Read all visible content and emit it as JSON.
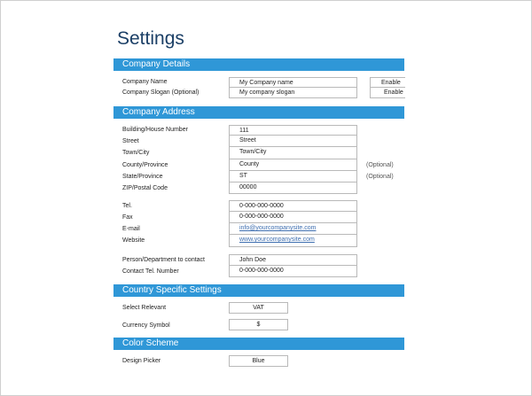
{
  "page_title": "Settings",
  "sections": {
    "company_details": "Company Details",
    "company_address": "Company Address",
    "country_settings": "Country Specific Settings",
    "color_scheme": "Color Scheme"
  },
  "company_details": {
    "name_label": "Company Name",
    "name_value": "My Company name",
    "slogan_label": "Company Slogan (Optional)",
    "slogan_value": "My company slogan",
    "enable_1": "Enable",
    "enable_2": "Enable"
  },
  "address": {
    "building_label": "Building/House Number",
    "building_value": "111",
    "street_label": "Street",
    "street_value": "Street",
    "town_label": "Town/City",
    "town_value": "Town/City",
    "county_label": "County/Province",
    "county_value": "County",
    "county_note": "(Optional)",
    "state_label": "State/Province",
    "state_value": "ST",
    "state_note": "(Optional)",
    "zip_label": "ZIP/Postal Code",
    "zip_value": "00000"
  },
  "contact": {
    "tel_label": "Tel.",
    "tel_value": "0-000-000-0000",
    "fax_label": "Fax",
    "fax_value": "0-000-000-0000",
    "email_label": "E-mail",
    "email_value": "info@yourcompanysite.com",
    "website_label": "Website",
    "website_value": "www.yourcompanysite.com"
  },
  "person": {
    "person_label": "Person/Department to contact",
    "person_value": "John Doe",
    "contact_tel_label": "Contact Tel. Number",
    "contact_tel_value": "0-000-000-0000"
  },
  "country": {
    "select_label": "Select Relevant",
    "select_value": "VAT",
    "currency_label": "Currency Symbol",
    "currency_value": "$"
  },
  "color": {
    "picker_label": "Design Picker",
    "picker_value": "Blue"
  },
  "colors": {
    "section_header": "#2f97d7",
    "title": "#1b3f66",
    "link": "#3f6fb0"
  }
}
